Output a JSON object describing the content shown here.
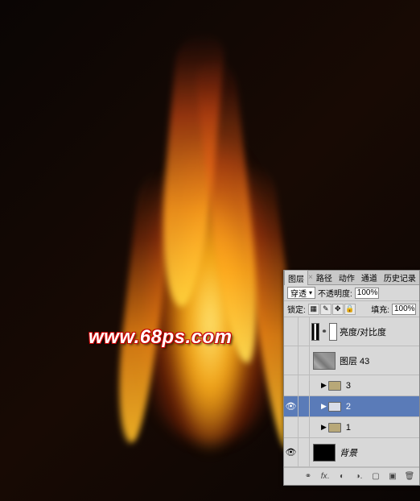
{
  "watermark": "www.68ps.com",
  "panel": {
    "tabs": {
      "layers": "图层",
      "paths": "路径",
      "actions": "动作",
      "channels": "通道",
      "history": "历史记录"
    },
    "blend_mode": "穿透",
    "opacity_label": "不透明度:",
    "opacity_value": "100%",
    "lock_label": "锁定:",
    "fill_label": "填充:",
    "fill_value": "100%",
    "layers": [
      {
        "name": "亮度/对比度",
        "type": "adjustment",
        "visible": false
      },
      {
        "name": "图层 43",
        "type": "layer",
        "visible": false
      },
      {
        "name": "3",
        "type": "group",
        "visible": false
      },
      {
        "name": "2",
        "type": "group",
        "visible": true,
        "selected": true
      },
      {
        "name": "1",
        "type": "group",
        "visible": false
      },
      {
        "name": "背景",
        "type": "layer",
        "visible": true,
        "bg": true
      }
    ]
  }
}
